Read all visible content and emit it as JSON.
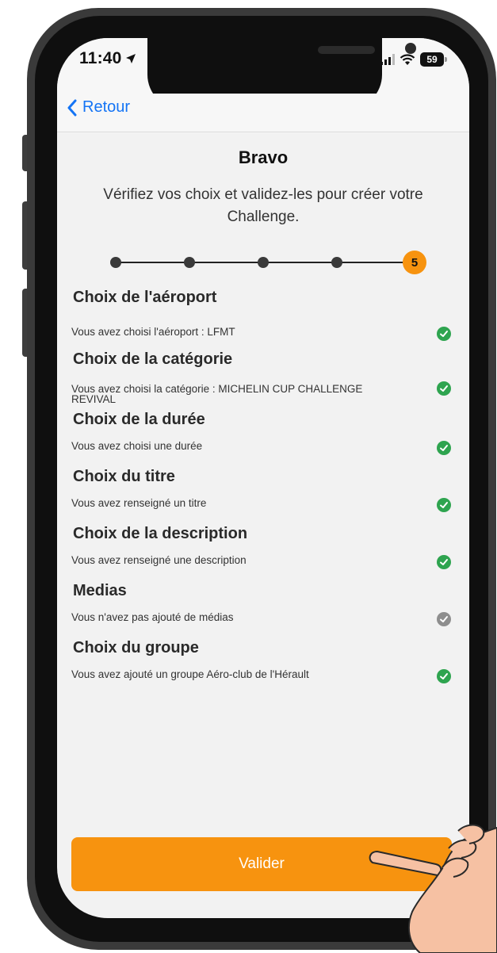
{
  "status_bar": {
    "time": "11:40",
    "battery": "59"
  },
  "nav": {
    "back_label": "Retour"
  },
  "header": {
    "title": "Bravo",
    "subtitle": "Vérifiez vos choix et validez-les pour créer votre Challenge."
  },
  "stepper": {
    "current_step": "5",
    "total_steps": 5
  },
  "sections": [
    {
      "title": "Choix de l'aéroport",
      "description": "Vous avez choisi l'aéroport : LFMT",
      "status": "done"
    },
    {
      "title": "Choix de la catégorie",
      "description": "Vous avez choisi la catégorie : MICHELIN CUP CHALLENGE REVIVAL",
      "status": "done"
    },
    {
      "title": "Choix de la durée",
      "description": "Vous avez choisi une durée",
      "status": "done"
    },
    {
      "title": "Choix du titre",
      "description": "Vous avez renseigné un titre",
      "status": "done"
    },
    {
      "title": "Choix de la description",
      "description": "Vous avez renseigné une description",
      "status": "done"
    },
    {
      "title": "Medias",
      "description": "Vous n'avez pas ajouté de médias",
      "status": "skipped"
    },
    {
      "title": "Choix du groupe",
      "description": "Vous avez ajouté un groupe Aéro-club de l'Hérault",
      "status": "done"
    }
  ],
  "cta": {
    "label": "Valider"
  },
  "colors": {
    "accent": "#f7930f",
    "link": "#1474f5",
    "check_done": "#2ea44f",
    "check_skipped": "#8e8e8e"
  }
}
